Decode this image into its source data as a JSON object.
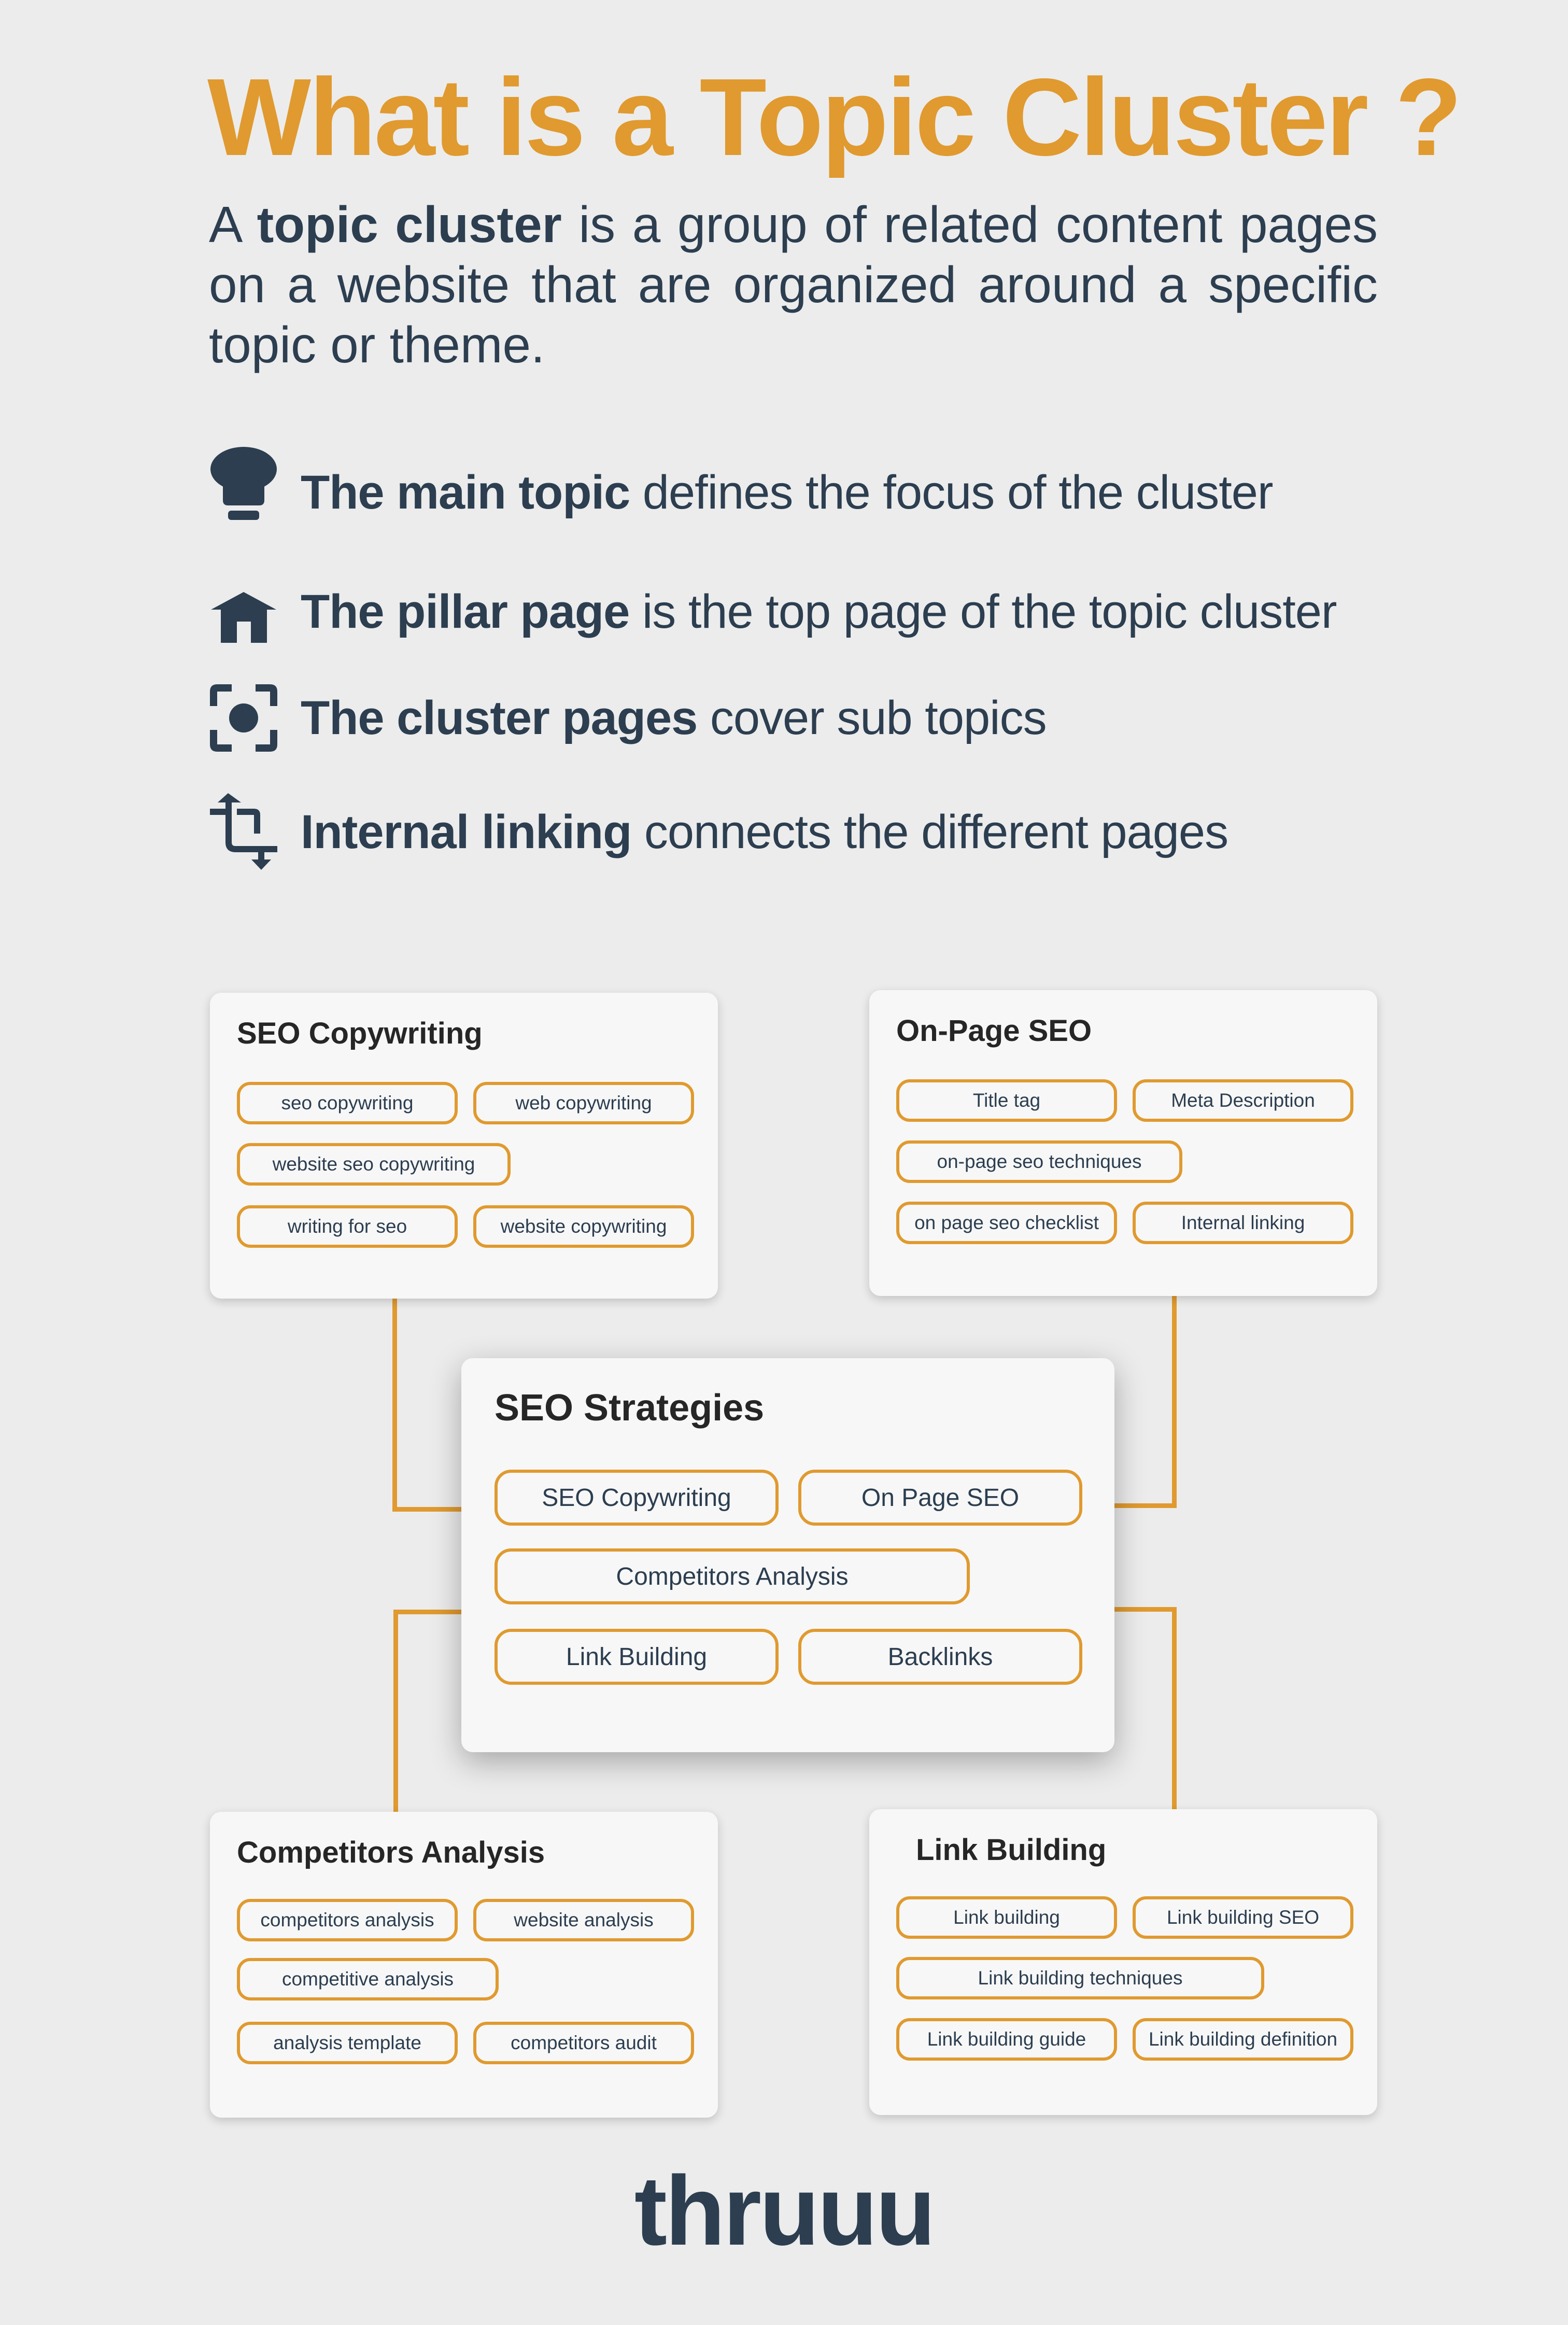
{
  "header": {
    "title": "What is a Topic Cluster ?",
    "intro_prefix": "A ",
    "intro_bold": "topic cluster",
    "intro_rest": " is a group of related content pages on a website that are organized around a specific topic or theme."
  },
  "features": [
    {
      "icon": "lightbulb-icon",
      "bold": "The main topic",
      "text": " defines the focus of the cluster"
    },
    {
      "icon": "home-icon",
      "bold": "The pillar page",
      "text": " is the top page of the topic cluster"
    },
    {
      "icon": "center-focus-icon",
      "bold": "The cluster pages",
      "text": " cover sub topics"
    },
    {
      "icon": "crop-linking-icon",
      "bold": "Internal linking",
      "text": " connects the different pages"
    }
  ],
  "colors": {
    "accent": "#e09a2f",
    "text": "#2c3e50",
    "background": "#ececec",
    "card": "#f7f7f7"
  },
  "cluster": {
    "pillar": {
      "title": "SEO Strategies",
      "chips": [
        "SEO Copywriting",
        "On Page SEO",
        "Competitors Analysis",
        "Link Building",
        "Backlinks"
      ]
    },
    "cards": [
      {
        "title": "SEO Copywriting",
        "chips": [
          "seo copywriting",
          "web copywriting",
          "website seo copywriting",
          "writing for seo",
          "website copywriting"
        ]
      },
      {
        "title": "On-Page SEO",
        "chips": [
          "Title tag",
          "Meta Description",
          "on-page seo techniques",
          "on page seo checklist",
          "Internal linking"
        ]
      },
      {
        "title": "Competitors Analysis",
        "chips": [
          "competitors analysis",
          "website analysis",
          "competitive analysis",
          "analysis template",
          "competitors audit"
        ]
      },
      {
        "title": "Link Building",
        "chips": [
          "Link building",
          "Link building SEO",
          "Link building techniques",
          "Link building guide",
          "Link building definition"
        ]
      }
    ]
  },
  "footer": {
    "logo": "thruuu"
  }
}
